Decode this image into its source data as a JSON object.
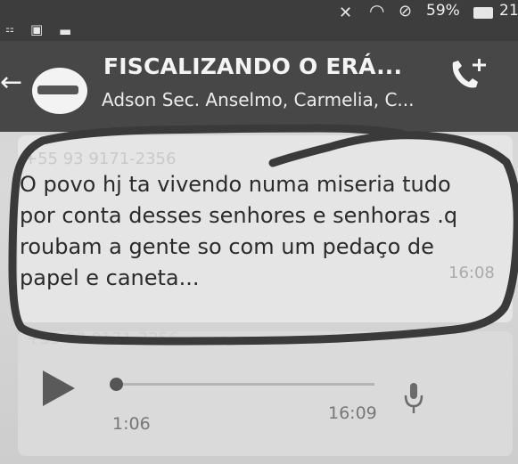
{
  "status_bar": {
    "battery_percent": "59%",
    "clock_partial": "21"
  },
  "header": {
    "title": "FISCALIZANDO O ERÁ...",
    "subtitle": "Adson Sec. Anselmo, Carmelia, C..."
  },
  "messages": [
    {
      "sender": "+55 93 9171-2356",
      "text": "O povo hj ta vivendo numa miseria tudo por conta desses senhores e senhoras .q roubam a gente so com um pedaço de papel e caneta...",
      "time": "16:08"
    }
  ],
  "audio_message": {
    "sender": "+55 93 9171-2356",
    "duration": "1:06",
    "time": "16:09",
    "progress": 0
  },
  "colors": {
    "header_bg": "#474747",
    "bubble_bg": "#e5e5e5",
    "marker": "#3a3a3a"
  }
}
